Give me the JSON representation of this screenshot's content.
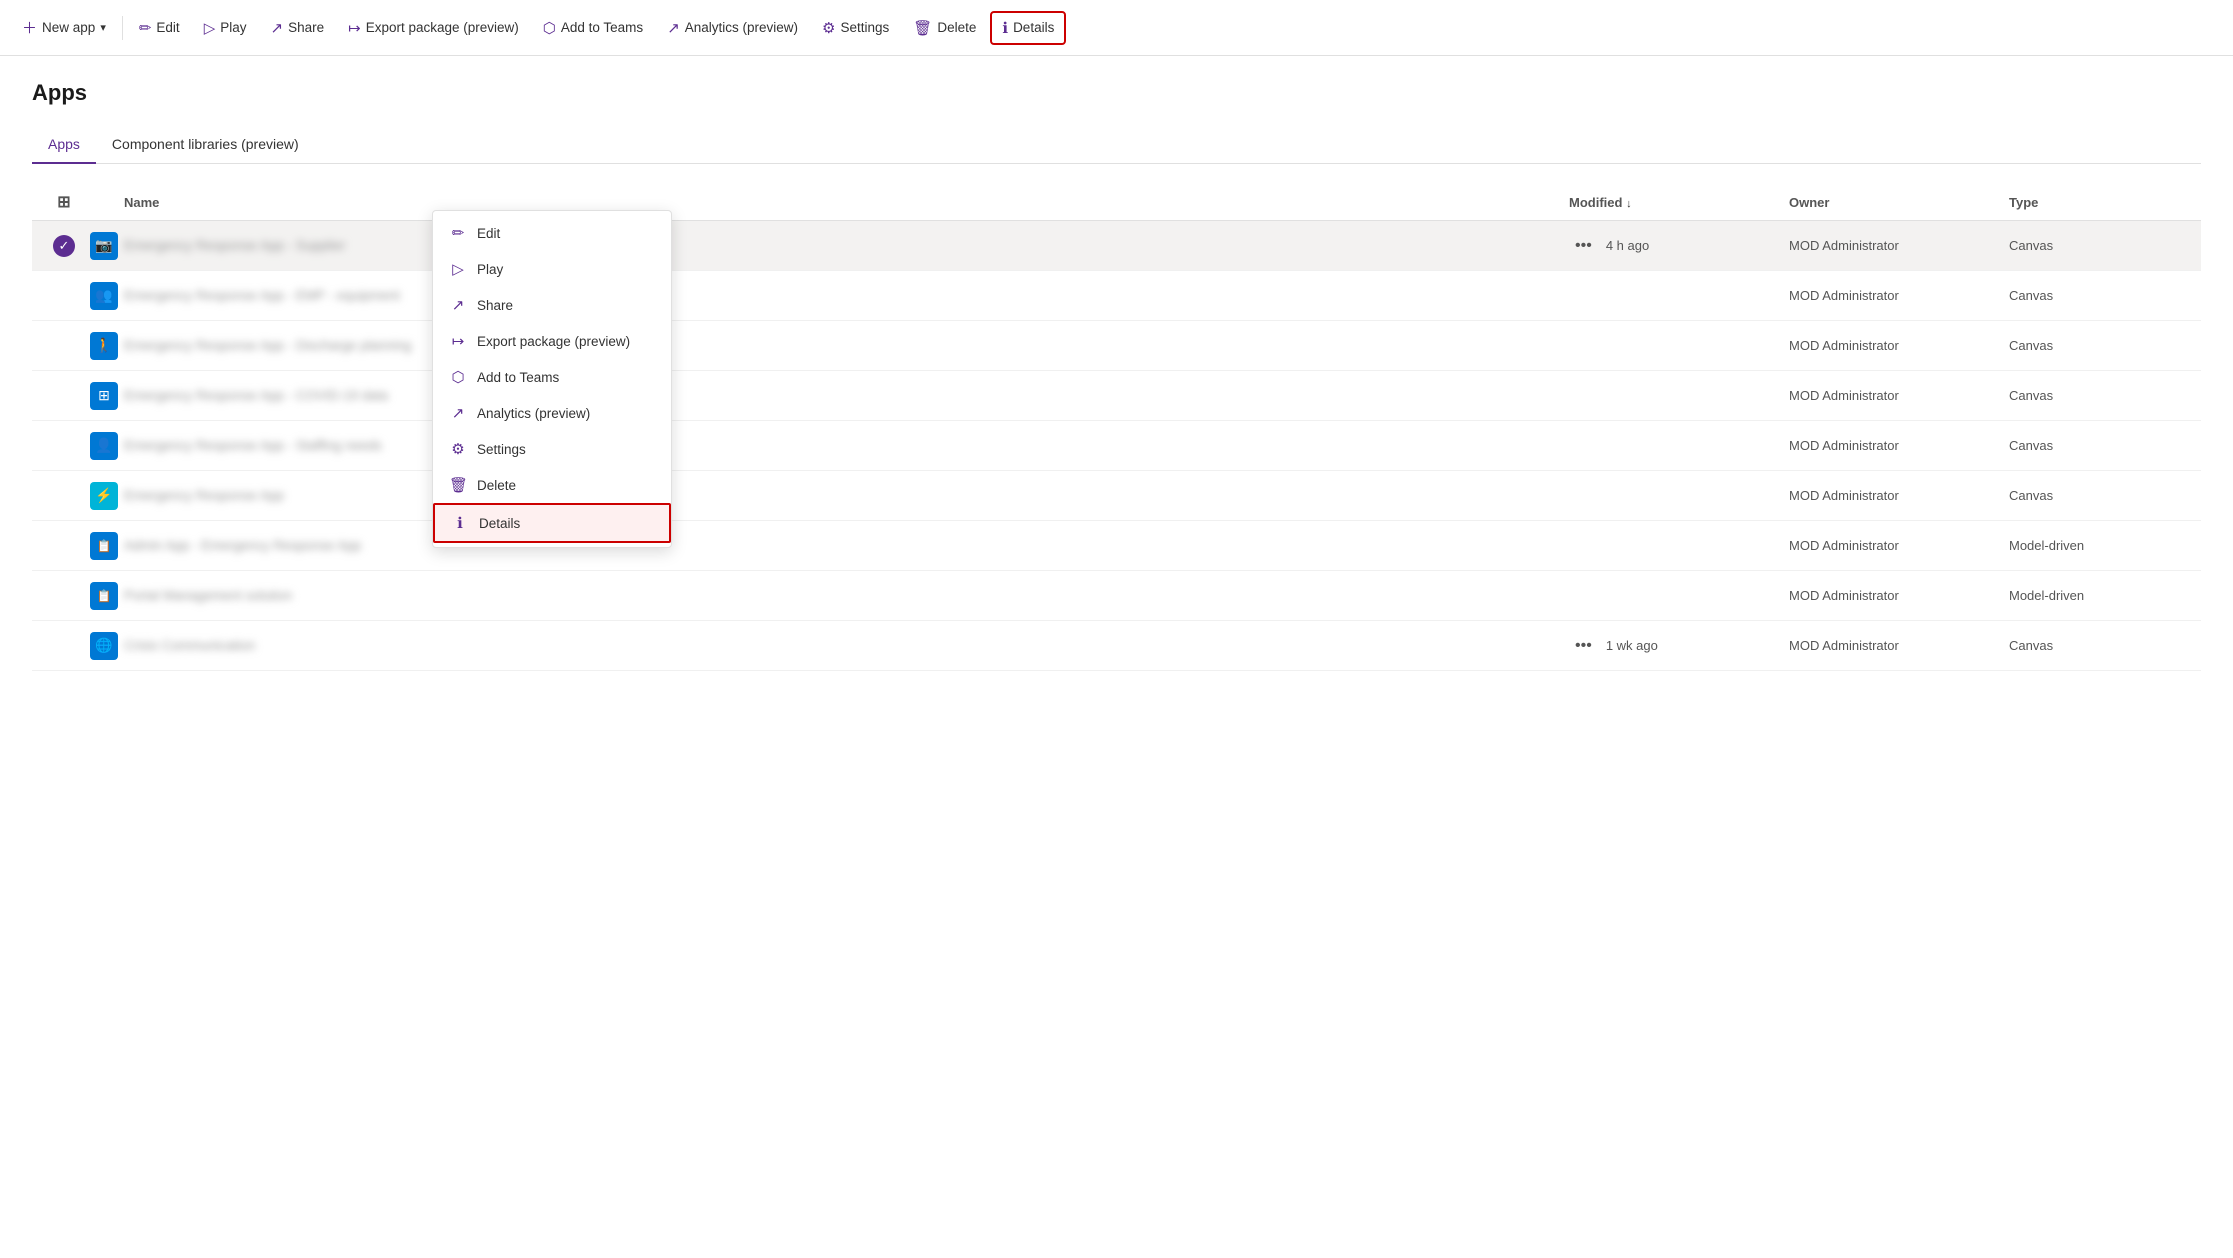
{
  "toolbar": {
    "newapp_label": "New app",
    "edit_label": "Edit",
    "play_label": "Play",
    "share_label": "Share",
    "export_label": "Export package (preview)",
    "addtoteams_label": "Add to Teams",
    "analytics_label": "Analytics (preview)",
    "settings_label": "Settings",
    "delete_label": "Delete",
    "details_label": "Details"
  },
  "page": {
    "title": "Apps"
  },
  "tabs": [
    {
      "label": "Apps",
      "active": true
    },
    {
      "label": "Component libraries (preview)",
      "active": false
    }
  ],
  "table": {
    "columns": {
      "name": "Name",
      "modified": "Modified",
      "owner": "Owner",
      "type": "Type"
    },
    "rows": [
      {
        "id": 1,
        "name": "Emergency Response App - Supplier",
        "blurred": true,
        "modified": "4 h ago",
        "owner": "MOD Administrator",
        "type": "Canvas",
        "selected": true,
        "iconType": "camera",
        "showMore": true
      },
      {
        "id": 2,
        "name": "Emergency Response App - EMP - equipment",
        "blurred": true,
        "modified": "",
        "owner": "MOD Administrator",
        "type": "Canvas",
        "selected": false,
        "iconType": "people",
        "showMore": false
      },
      {
        "id": 3,
        "name": "Emergency Response App - Discharge planning",
        "blurred": true,
        "modified": "",
        "owner": "MOD Administrator",
        "type": "Canvas",
        "selected": false,
        "iconType": "person",
        "showMore": false
      },
      {
        "id": 4,
        "name": "Emergency Response App - COVID-19 data",
        "blurred": true,
        "modified": "",
        "owner": "MOD Administrator",
        "type": "Canvas",
        "selected": false,
        "iconType": "grid",
        "showMore": false
      },
      {
        "id": 5,
        "name": "Emergency Response App - Staffing needs",
        "blurred": true,
        "modified": "",
        "owner": "MOD Administrator",
        "type": "Canvas",
        "selected": false,
        "iconType": "people2",
        "showMore": false
      },
      {
        "id": 6,
        "name": "Emergency Response App",
        "blurred": true,
        "modified": "",
        "owner": "MOD Administrator",
        "type": "Canvas",
        "selected": false,
        "iconType": "teal",
        "showMore": false
      },
      {
        "id": 7,
        "name": "Admin App - Emergency Response App",
        "blurred": true,
        "modified": "",
        "owner": "MOD Administrator",
        "type": "Model-driven",
        "selected": false,
        "iconType": "model1",
        "showMore": false
      },
      {
        "id": 8,
        "name": "Portal Management solution",
        "blurred": true,
        "modified": "",
        "owner": "MOD Administrator",
        "type": "Model-driven",
        "selected": false,
        "iconType": "model2",
        "showMore": false
      },
      {
        "id": 9,
        "name": "Crisis Communication",
        "blurred": true,
        "modified": "1 wk ago",
        "owner": "MOD Administrator",
        "type": "Canvas",
        "selected": false,
        "iconType": "globe",
        "showMore": true
      }
    ]
  },
  "contextMenu": {
    "items": [
      {
        "id": "edit",
        "label": "Edit",
        "icon": "pencil"
      },
      {
        "id": "play",
        "label": "Play",
        "icon": "play"
      },
      {
        "id": "share",
        "label": "Share",
        "icon": "share"
      },
      {
        "id": "export",
        "label": "Export package (preview)",
        "icon": "export"
      },
      {
        "id": "addtoteams",
        "label": "Add to Teams",
        "icon": "teams"
      },
      {
        "id": "analytics",
        "label": "Analytics (preview)",
        "icon": "analytics"
      },
      {
        "id": "settings",
        "label": "Settings",
        "icon": "settings"
      },
      {
        "id": "delete",
        "label": "Delete",
        "icon": "delete"
      },
      {
        "id": "details",
        "label": "Details",
        "icon": "info",
        "highlighted": true
      }
    ]
  }
}
